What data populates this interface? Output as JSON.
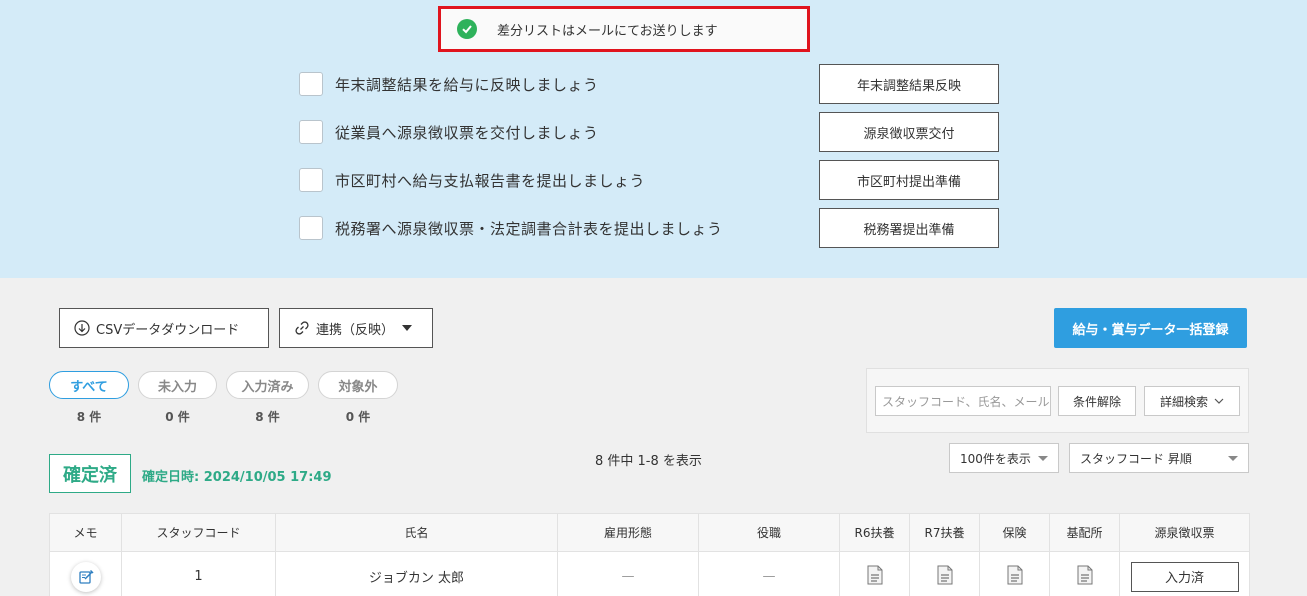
{
  "toast": {
    "message": "差分リストはメールにてお送りします"
  },
  "tasks": [
    {
      "label": "年末調整結果を給与に反映しましょう",
      "button": "年末調整結果反映"
    },
    {
      "label": "従業員へ源泉徴収票を交付しましょう",
      "button": "源泉徴収票交付"
    },
    {
      "label": "市区町村へ給与支払報告書を提出しましょう",
      "button": "市区町村提出準備"
    },
    {
      "label": "税務署へ源泉徴収票・法定調書合計表を提出しましょう",
      "button": "税務署提出準備"
    }
  ],
  "toolbar": {
    "csv_download": "CSVデータダウンロード",
    "link_reflect": "連携（反映）",
    "bulk_register": "給与・賞与データ一括登録"
  },
  "filters": [
    {
      "label": "すべて",
      "count": "8 件"
    },
    {
      "label": "未入力",
      "count": "0 件"
    },
    {
      "label": "入力済み",
      "count": "8 件"
    },
    {
      "label": "対象外",
      "count": "0 件"
    }
  ],
  "search": {
    "placeholder": "スタッフコード、氏名、メールアドレス",
    "clear_label": "条件解除",
    "detail_label": "詳細検索"
  },
  "status": {
    "label": "確定済",
    "date": "確定日時: 2024/10/05 17:49"
  },
  "summary": "8 件中 1-8 を表示",
  "per_page": "100件を表示",
  "sort": "スタッフコード 昇順",
  "table": {
    "headers": [
      "メモ",
      "スタッフコード",
      "氏名",
      "雇用形態",
      "役職",
      "R6扶養",
      "R7扶養",
      "保険",
      "基配所",
      "源泉徴収票"
    ],
    "rows": [
      {
        "code": "1",
        "name": "ジョブカン 太郎",
        "employment": "—",
        "position": "—",
        "status_button": "入力済"
      }
    ]
  },
  "colors": {
    "accent": "#2f9ee0",
    "success": "#2eaa87",
    "highlight": "#e0141e",
    "panel": "#d4ebf8"
  }
}
